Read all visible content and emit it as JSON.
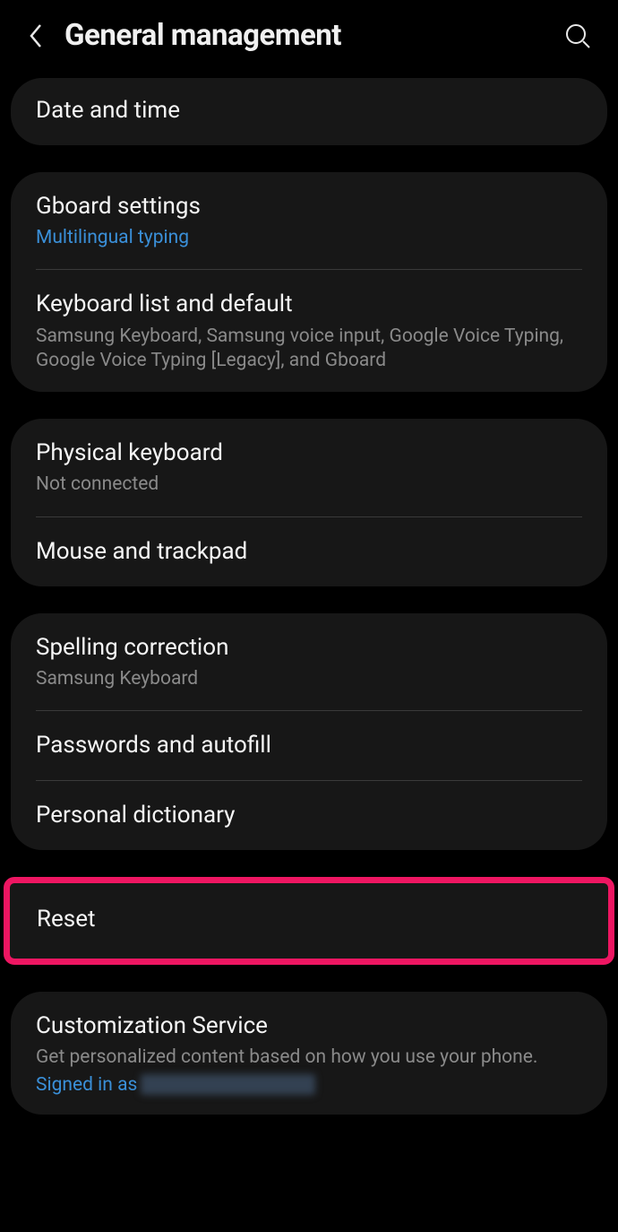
{
  "header": {
    "title": "General management"
  },
  "groups": [
    {
      "items": [
        {
          "title": "Date and time"
        }
      ]
    },
    {
      "items": [
        {
          "title": "Gboard settings",
          "subtitle_blue": "Multilingual typing"
        },
        {
          "title": "Keyboard list and default",
          "subtitle": "Samsung Keyboard, Samsung voice input, Google Voice Typing, Google Voice Typing [Legacy], and Gboard"
        }
      ]
    },
    {
      "items": [
        {
          "title": "Physical keyboard",
          "subtitle": "Not connected"
        },
        {
          "title": "Mouse and trackpad"
        }
      ]
    },
    {
      "items": [
        {
          "title": "Spelling correction",
          "subtitle": "Samsung Keyboard"
        },
        {
          "title": "Passwords and autofill"
        },
        {
          "title": "Personal dictionary"
        }
      ]
    },
    {
      "highlighted": true,
      "items": [
        {
          "title": "Reset"
        }
      ]
    },
    {
      "items": [
        {
          "title": "Customization Service",
          "subtitle": "Get personalized content based on how you use your phone.",
          "signed_in_prefix": "Signed in as"
        }
      ]
    }
  ]
}
